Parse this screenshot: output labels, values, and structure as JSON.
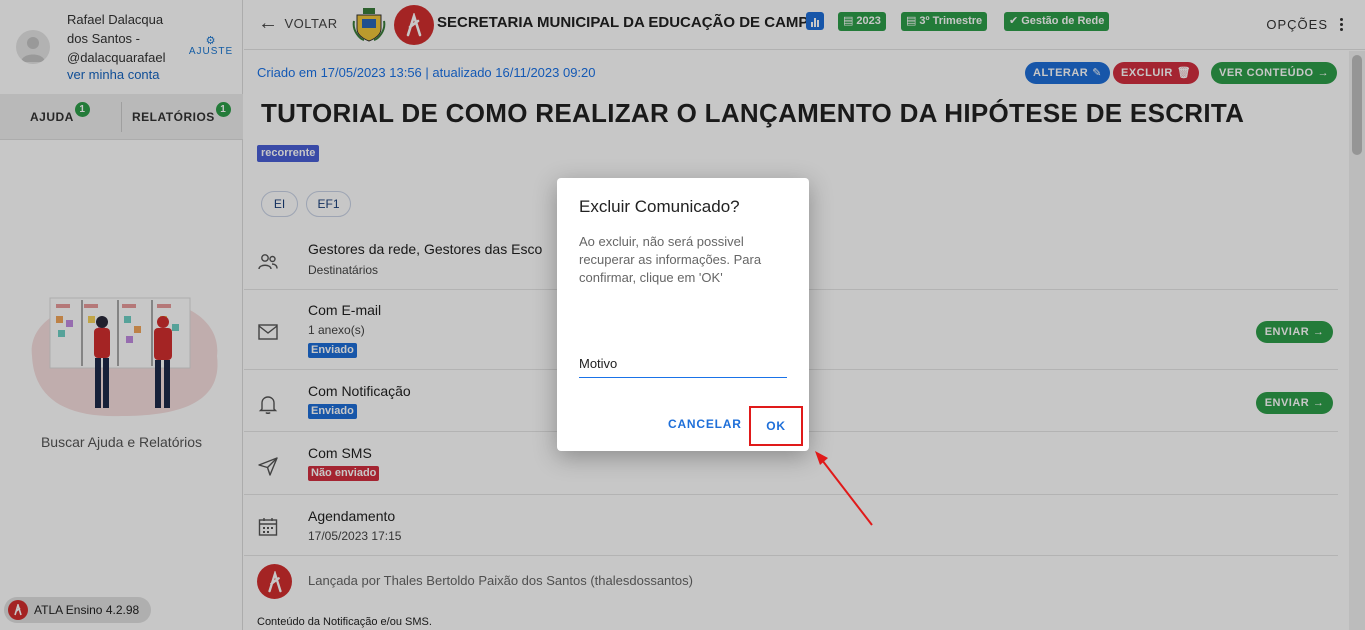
{
  "user": {
    "name": "Rafael Dalacqua dos Santos - @dalacquarafael",
    "account_link": "ver minha conta",
    "settings_label": "AJUSTE"
  },
  "sidebar": {
    "tabs": [
      {
        "label": "AJUDA",
        "count": "1"
      },
      {
        "label": "RELATÓRIOS",
        "count": "1"
      }
    ],
    "help_text": "Buscar Ajuda e Relatórios",
    "version": "ATLA Ensino 4.2.98"
  },
  "topbar": {
    "back_label": "VOLTAR",
    "org_title": "SECRETARIA MUNICIPAL DA EDUCAÇÃO DE CAMPO",
    "chips": [
      "2023",
      "3º Trimestre",
      "Gestão de Rede"
    ],
    "options_label": "OPÇÕES"
  },
  "page": {
    "meta": "Criado em 17/05/2023 13:56 | atualizado 16/11/2023 09:20",
    "actions": {
      "edit": "ALTERAR",
      "delete": "EXCLUIR",
      "view": "VER CONTEÚDO"
    },
    "title": "TUTORIAL DE COMO REALIZAR O LANÇAMENTO DA HIPÓTESE DE ESCRITA",
    "tag": "recorrente",
    "levels": [
      "EI",
      "EF1"
    ],
    "recipients": {
      "title": "Gestores da rede, Gestores das Esco",
      "subtitle": "Destinatários"
    },
    "email": {
      "title": "Com E-mail",
      "subtitle": "1 anexo(s)",
      "status": "Enviado",
      "send": "ENVIAR"
    },
    "notification": {
      "title": "Com Notificação",
      "status": "Enviado",
      "send": "ENVIAR"
    },
    "sms": {
      "title": "Com SMS",
      "status": "Não enviado"
    },
    "schedule": {
      "title": "Agendamento",
      "value": "17/05/2023 17:15"
    },
    "launched_by": "Lançada por Thales Bertoldo Paixão dos Santos (thalesdossantos)",
    "content_label": "Conteúdo da Notificação e/ou SMS."
  },
  "dialog": {
    "title": "Excluir Comunicado?",
    "body": "Ao excluir, não será possivel recuperar as informações. Para confirmar, clique em 'OK'",
    "input_value": "Motivo",
    "cancel": "CANCELAR",
    "ok": "OK"
  },
  "colors": {
    "primary": "#1e6fd9",
    "success": "#2e9e49",
    "danger": "#d32f3f",
    "brand": "#d32f2f",
    "highlight": "#e01a1a"
  },
  "icons": {
    "back": "arrow-left-icon",
    "options": "kebab-icon",
    "recipients": "users-icon",
    "email": "envelope-icon",
    "notification": "bell-icon",
    "sms": "send-icon",
    "schedule": "calendar-icon"
  }
}
